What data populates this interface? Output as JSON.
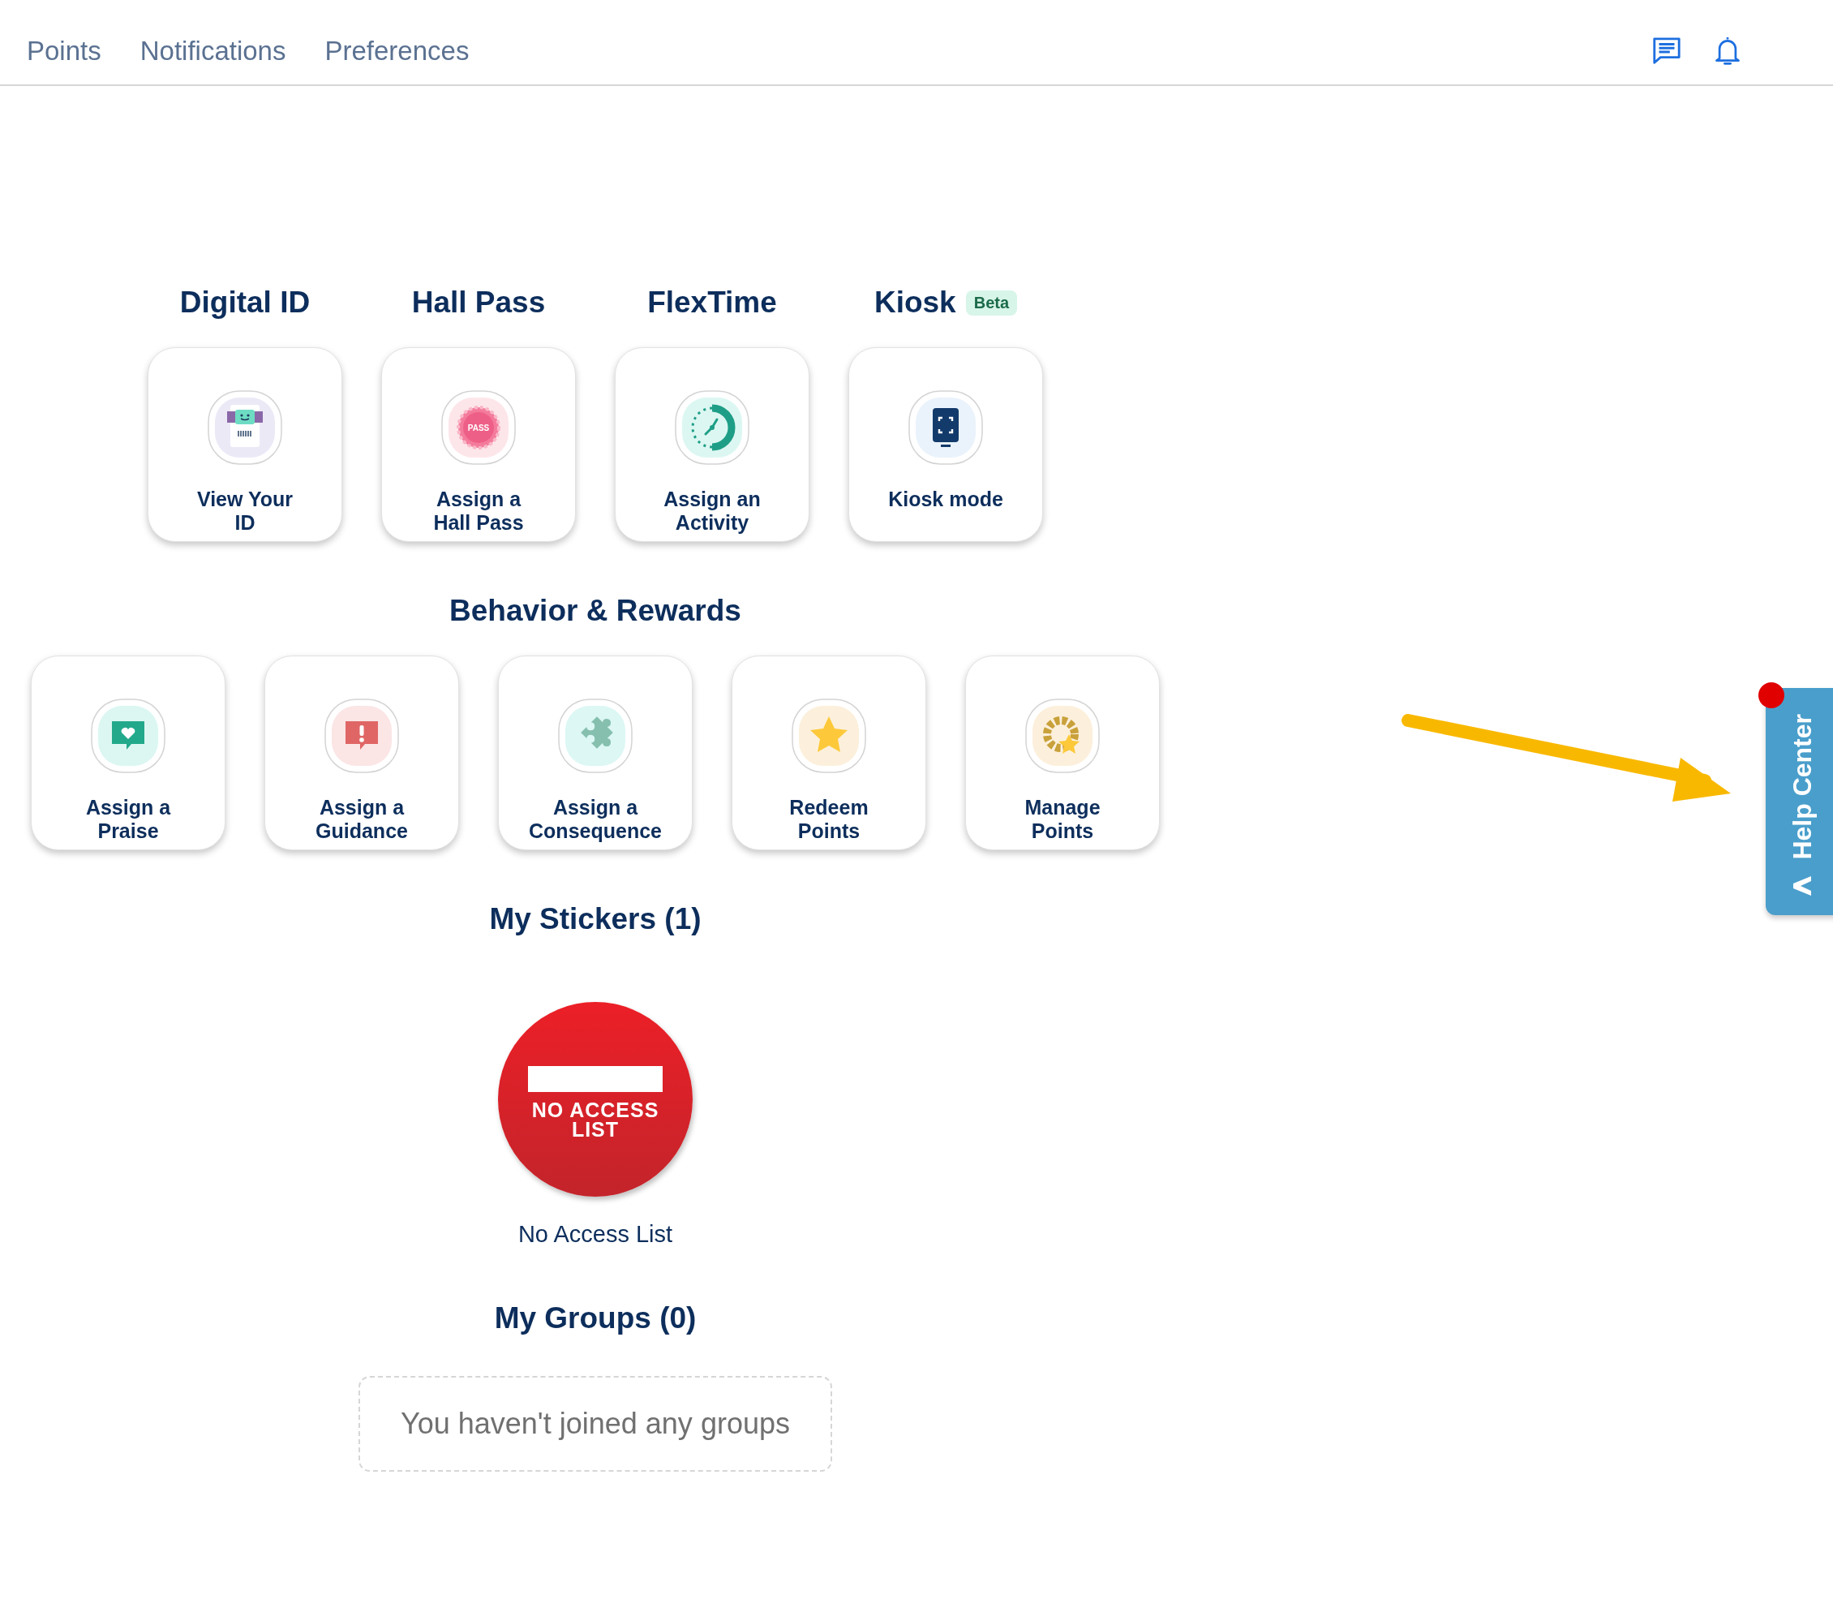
{
  "nav": {
    "tabs": [
      {
        "label": "Points"
      },
      {
        "label": "Notifications"
      },
      {
        "label": "Preferences"
      }
    ]
  },
  "quick_actions": [
    {
      "heading": "Digital ID",
      "label": "View Your ID",
      "kind": "id"
    },
    {
      "heading": "Hall Pass",
      "label": "Assign a Hall Pass",
      "kind": "pass",
      "icon_text": "PASS"
    },
    {
      "heading": "FlexTime",
      "label": "Assign an Activity",
      "kind": "activity"
    },
    {
      "heading": "Kiosk",
      "badge": "Beta",
      "label": "Kiosk mode",
      "kind": "kiosk"
    }
  ],
  "behavior": {
    "heading": "Behavior & Rewards",
    "cards": [
      {
        "label": "Assign a Praise",
        "kind": "praise"
      },
      {
        "label": "Assign a Guidance",
        "kind": "guidance"
      },
      {
        "label": "Assign a Consequence",
        "kind": "consequence"
      },
      {
        "label": "Redeem Points",
        "kind": "redeem"
      },
      {
        "label": "Manage Points",
        "kind": "manage"
      }
    ]
  },
  "stickers": {
    "heading": "My Stickers (1)",
    "items": [
      {
        "sticker_text": "NO ACCESS LIST",
        "name": "No Access List"
      }
    ]
  },
  "groups": {
    "heading": "My Groups (0)",
    "empty_message": "You haven't joined any groups"
  },
  "help_center": {
    "label": "Help Center"
  }
}
